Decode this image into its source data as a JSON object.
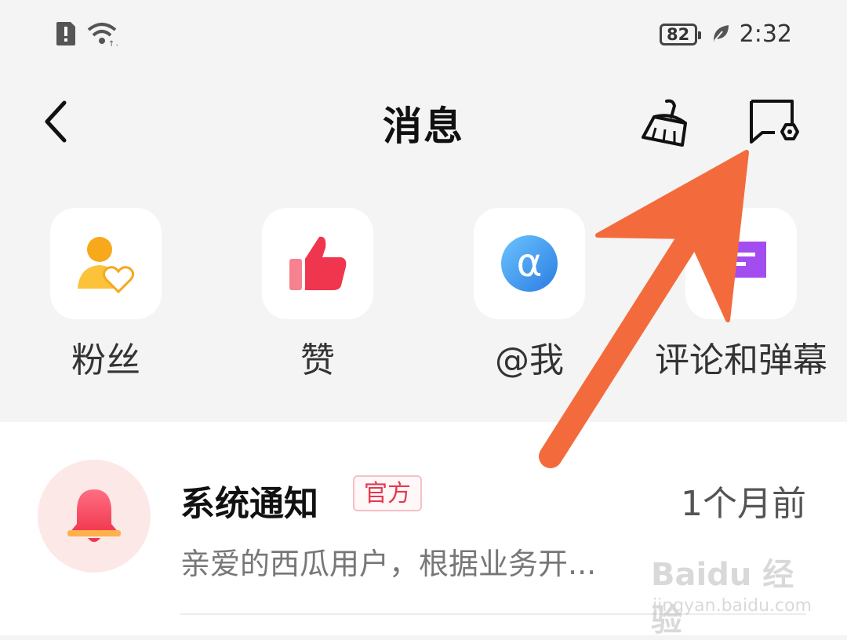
{
  "status_bar": {
    "battery": "82",
    "time": "2:32",
    "icons": [
      "alert-icon",
      "wifi-icon",
      "battery-icon",
      "leaf-icon"
    ]
  },
  "nav": {
    "title": "消息",
    "icons": [
      "back-icon",
      "broom-icon",
      "message-settings-icon"
    ]
  },
  "categories": [
    {
      "label": "粉丝",
      "icon": "fans-icon",
      "color": "#f5b400"
    },
    {
      "label": "赞",
      "icon": "thumbs-up-icon",
      "color": "#f0364e"
    },
    {
      "label": "@我",
      "icon": "at-icon",
      "color": "#2d8cf0"
    },
    {
      "label": "评论和弹幕",
      "icon": "comment-icon",
      "color": "#a34df0"
    }
  ],
  "notifications": [
    {
      "name": "系统通知",
      "badge": "官方",
      "time": "1个月前",
      "preview": "亲爱的西瓜用户，根据业务开...",
      "icon": "bell-icon"
    }
  ],
  "annotation": {
    "color": "#f36b3c"
  },
  "watermark": {
    "brand": "Baidu 经验",
    "url": "jingyan.baidu.com"
  }
}
